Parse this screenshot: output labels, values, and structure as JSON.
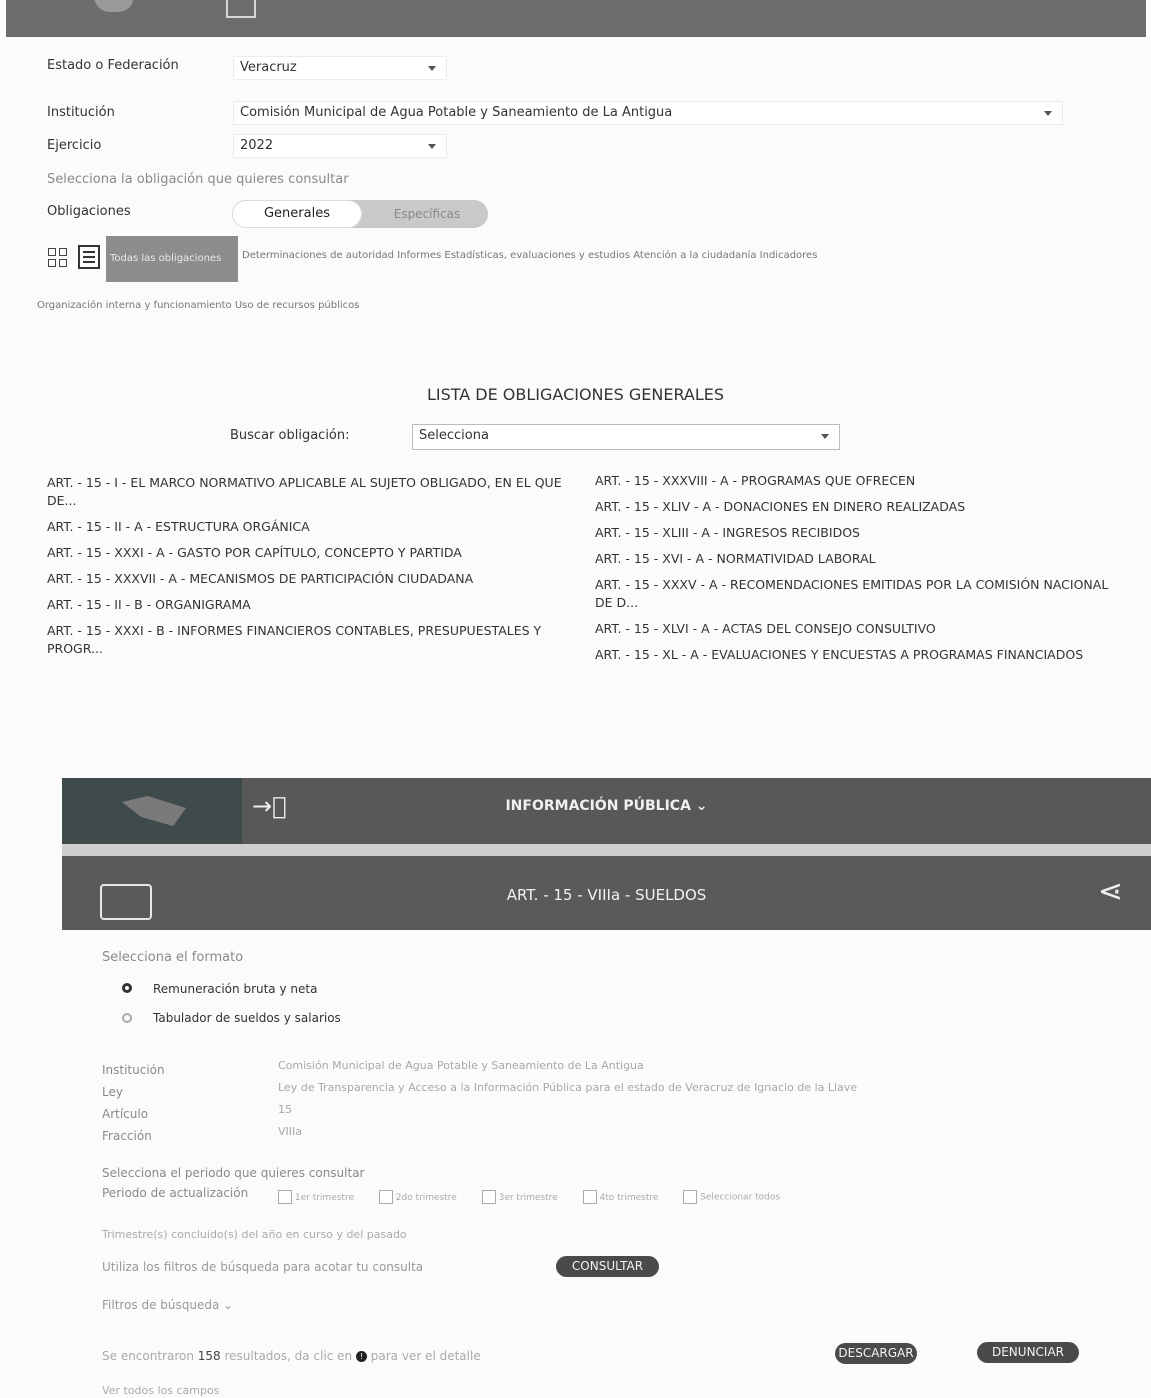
{
  "filters": {
    "estado_label": "Estado o Federación",
    "estado_value": "Veracruz",
    "institucion_label": "Institución",
    "institucion_value": "Comisión Municipal de Agua Potable y Saneamiento de La Antigua",
    "ejercicio_label": "Ejercicio",
    "ejercicio_value": "2022",
    "prompt": "Selecciona la obligación que quieres consultar",
    "obligaciones_label": "Obligaciones",
    "toggle_generales": "Generales",
    "toggle_especificas": "Específicas"
  },
  "categories": {
    "active": "Todas las obligaciones",
    "row1": [
      "Determinaciones de autoridad",
      "Informes",
      "Estadísticas, evaluaciones y estudios",
      "Atención a la ciudadanía",
      "Indicadores"
    ],
    "row2": [
      "Organización interna y funcionamiento",
      "Uso de recursos públicos"
    ]
  },
  "list": {
    "title": "LISTA DE OBLIGACIONES GENERALES",
    "search_label": "Buscar obligación:",
    "search_value": "Selecciona",
    "left": [
      "ART. - 15 - I - EL MARCO NORMATIVO APLICABLE AL SUJETO OBLIGADO, EN EL QUE DE...",
      "ART. - 15 - II - A - ESTRUCTURA ORGÁNICA",
      "ART. - 15 - XXXI - A - GASTO POR CAPÍTULO, CONCEPTO Y PARTIDA",
      "ART. - 15 - XXXVII - A - MECANISMOS DE PARTICIPACIÓN CIUDADANA",
      "ART. - 15 - II - B - ORGANIGRAMA",
      "ART. - 15 - XXXI - B - INFORMES FINANCIEROS CONTABLES, PRESUPUESTALES Y PROGR..."
    ],
    "right": [
      "ART. - 15 - XXXVIII - A - PROGRAMAS QUE OFRECEN",
      "ART. - 15 - XLIV - A - DONACIONES EN DINERO REALIZADAS",
      "ART. - 15 - XLIII - A - INGRESOS RECIBIDOS",
      "ART. - 15 - XVI - A - NORMATIVIDAD LABORAL",
      "ART. - 15 - XXXV - A - RECOMENDACIONES EMITIDAS POR LA COMISIÓN NACIONAL DE D...",
      "ART. - 15 - XLVI - A - ACTAS DEL CONSEJO CONSULTIVO",
      "ART. - 15 - XL - A - EVALUACIONES Y ENCUESTAS A PROGRAMAS FINANCIADOS"
    ]
  },
  "detail": {
    "nav_title": "INFORMACIÓN PÚBLICA ⌄",
    "header_title": "ART. - 15 - VIIIa - SUELDOS",
    "format_prompt": "Selecciona el formato",
    "format_options": [
      "Remuneración bruta y neta",
      "Tabulador de sueldos y salarios"
    ],
    "meta_labels": [
      "Institución",
      "Ley",
      "Artículo",
      "Fracción"
    ],
    "meta_values": [
      "Comisión Municipal de Agua Potable y Saneamiento de La Antigua",
      "Ley de Transparencia y Acceso a la Información Pública para el estado de Veracruz de Ignacio de la Llave",
      "15",
      "VIIIa"
    ],
    "period_prompt": "Selecciona el periodo que quieres consultar",
    "period_label": "Periodo de actualización",
    "period_options": [
      "1er trimestre",
      "2do trimestre",
      "3er trimestre",
      "4to trimestre",
      "Seleccionar todos"
    ],
    "trimestre_note": "Trimestre(s) concluido(s) del año en curso y del pasado",
    "filters_note": "Utiliza los filtros de búsqueda para acotar tu consulta",
    "consultar": "CONSULTAR",
    "filtros_busqueda": "Filtros de búsqueda ⌄",
    "results_pre": "Se encontraron ",
    "results_count": "158",
    "results_post": " resultados, da clic en",
    "results_post2": "para ver el detalle",
    "descargar": "DESCARGAR",
    "denunciar": "DENUNCIAR",
    "ver_todos": "Ver todos los campos"
  }
}
